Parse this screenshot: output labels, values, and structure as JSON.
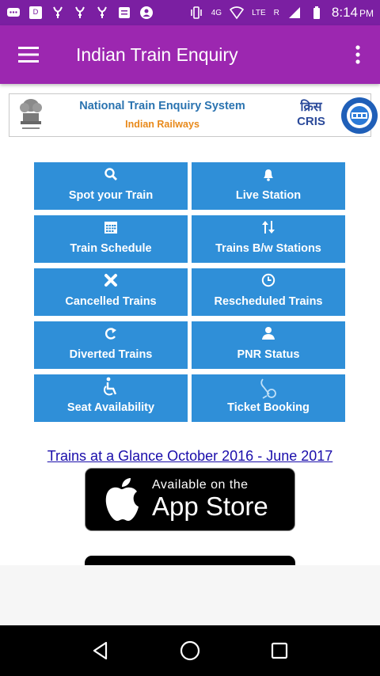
{
  "status_bar": {
    "time": "8:14",
    "ampm": "PM",
    "network": "4G",
    "lte": "LTE",
    "roaming": "R"
  },
  "app_bar": {
    "title": "Indian Train Enquiry"
  },
  "banner": {
    "title": "National Train Enquiry System",
    "subtitle": "Indian Railways",
    "cris_hindi": "क्रिस",
    "cris_english": "CRIS"
  },
  "tiles": [
    {
      "label": "Spot your Train",
      "icon": "search-icon"
    },
    {
      "label": "Live Station",
      "icon": "bell-icon"
    },
    {
      "label": "Train Schedule",
      "icon": "calendar-icon"
    },
    {
      "label": "Trains B/w Stations",
      "icon": "arrows-updown-icon"
    },
    {
      "label": "Cancelled Trains",
      "icon": "close-icon"
    },
    {
      "label": "Rescheduled Trains",
      "icon": "clock-icon"
    },
    {
      "label": "Diverted Trains",
      "icon": "redo-arrow-icon"
    },
    {
      "label": "PNR Status",
      "icon": "user-icon"
    },
    {
      "label": "Seat Availability",
      "icon": "wheelchair-icon"
    },
    {
      "label": "Ticket Booking",
      "icon": "booking-icon"
    }
  ],
  "links": {
    "glance": "Trains at a Glance October 2016 - June 2017"
  },
  "appstore": {
    "small": "Available on the",
    "big": "App Store"
  },
  "colors": {
    "status_bar": "#7b1fa2",
    "app_bar": "#9c27b0",
    "tile": "#2f8fd8",
    "link": "#1a0dab"
  }
}
